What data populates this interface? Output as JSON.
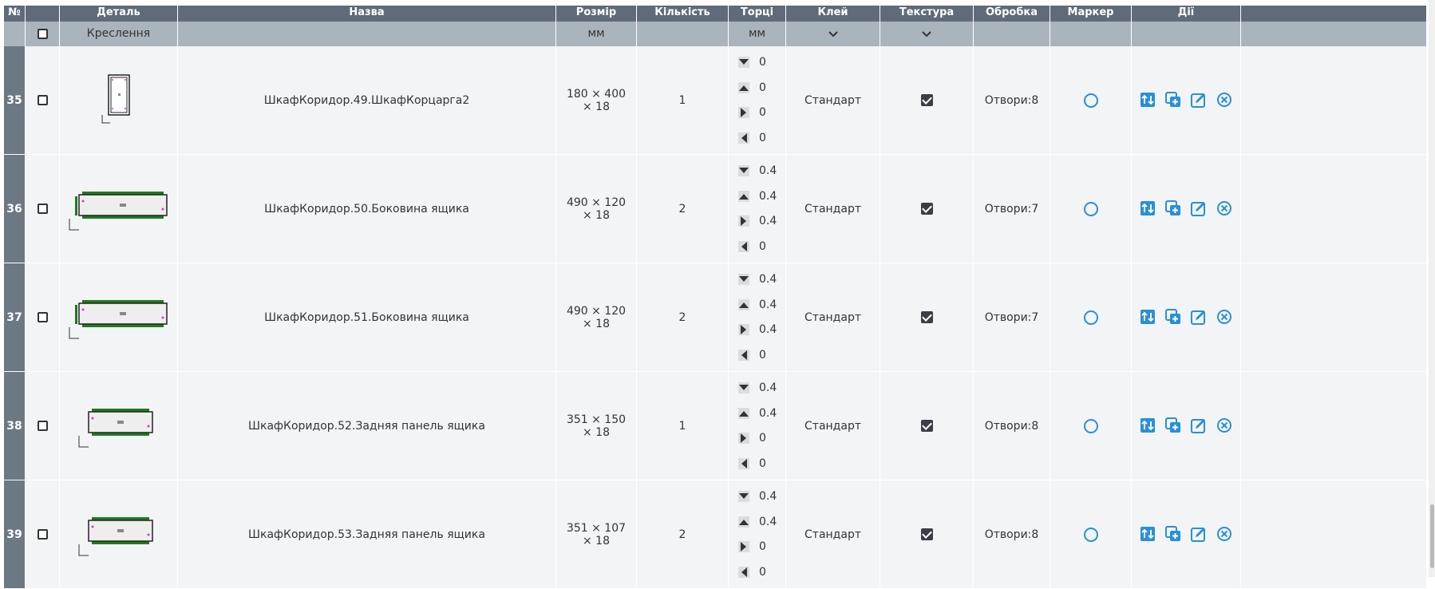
{
  "header": {
    "num": "№",
    "detail": "Деталь",
    "drawing": "Креслення",
    "name": "Назва",
    "size": "Розмір",
    "size_unit": "мм",
    "qty": "Кількість",
    "edges": "Торці",
    "edges_unit": "мм",
    "glue": "Клей",
    "texture": "Текстура",
    "processing": "Обробка",
    "marker": "Маркер",
    "actions": "Дії"
  },
  "rows": [
    {
      "num": "35",
      "name": "ШкафКоридор.49.ШкафКорцарга2",
      "size": "180 × 400 × 18",
      "qty": "1",
      "edges": [
        "0",
        "0",
        "0",
        "0"
      ],
      "glue": "Стандарт",
      "texture": true,
      "processing": "Отвори:8"
    },
    {
      "num": "36",
      "name": "ШкафКоридор.50.Боковина ящика",
      "size": "490 × 120 × 18",
      "qty": "2",
      "edges": [
        "0.4",
        "0.4",
        "0.4",
        "0"
      ],
      "glue": "Стандарт",
      "texture": true,
      "processing": "Отвори:7"
    },
    {
      "num": "37",
      "name": "ШкафКоридор.51.Боковина ящика",
      "size": "490 × 120 × 18",
      "qty": "2",
      "edges": [
        "0.4",
        "0.4",
        "0.4",
        "0"
      ],
      "glue": "Стандарт",
      "texture": true,
      "processing": "Отвори:7"
    },
    {
      "num": "38",
      "name": "ШкафКоридор.52.Задняя панель ящика",
      "size": "351 × 150 × 18",
      "qty": "1",
      "edges": [
        "0.4",
        "0.4",
        "0",
        "0"
      ],
      "glue": "Стандарт",
      "texture": true,
      "processing": "Отвори:8"
    },
    {
      "num": "39",
      "name": "ШкафКоридор.53.Задняя панель ящика",
      "size": "351 × 107 × 18",
      "qty": "2",
      "edges": [
        "0.4",
        "0.4",
        "0",
        "0"
      ],
      "glue": "Стандарт",
      "texture": true,
      "processing": "Отвори:8"
    }
  ],
  "colors": {
    "header_dark": "#5f6b78",
    "header_light": "#aab4bd",
    "row_bg": "#f2f4f6",
    "action_blue": "#2a8fd6",
    "edge_green": "#1f7a1f",
    "hole_magenta": "#d63ad6"
  },
  "icons": {
    "edge_icons": [
      "edge-bottom-icon",
      "edge-top-icon",
      "edge-right-icon",
      "edge-left-icon"
    ],
    "actions": [
      "swap-icon",
      "duplicate-icon",
      "edit-icon",
      "delete-icon"
    ]
  }
}
